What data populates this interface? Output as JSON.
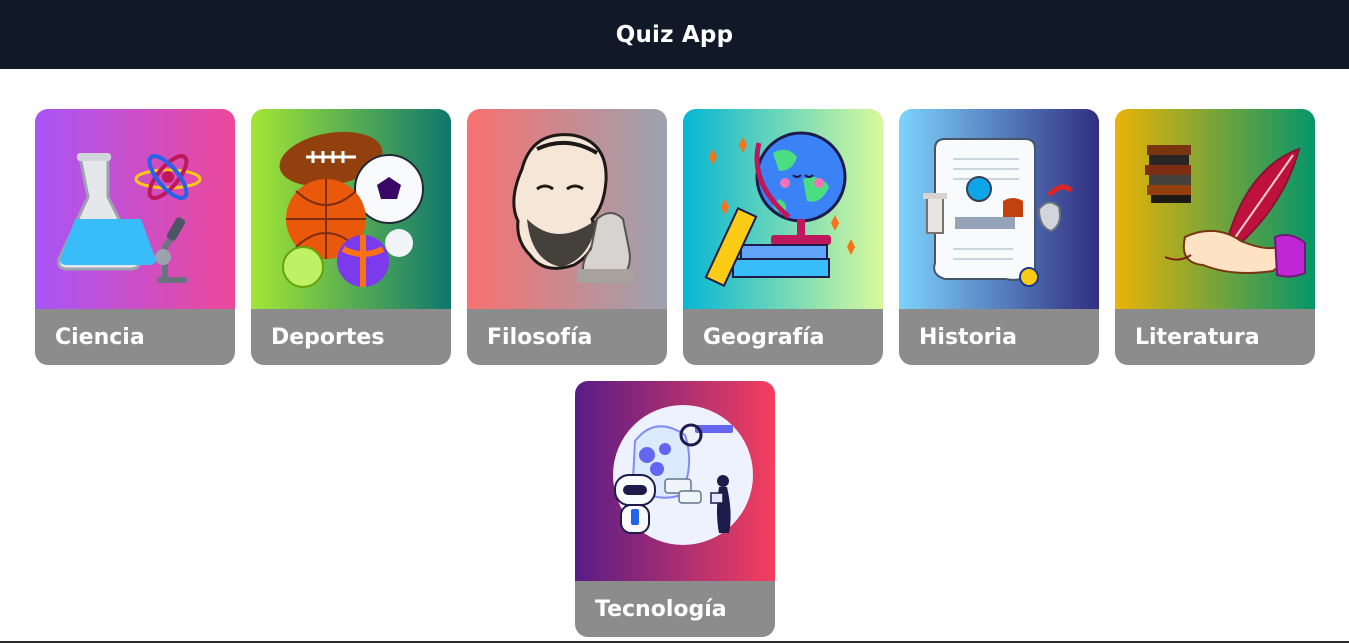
{
  "header": {
    "title": "Quiz App"
  },
  "categories": [
    {
      "label": "Ciencia",
      "icon": "science-flask-icon",
      "gradient": [
        "#a855f7",
        "#ec4899"
      ]
    },
    {
      "label": "Deportes",
      "icon": "sports-balls-icon",
      "gradient": [
        "#a3e635",
        "#0f766e"
      ]
    },
    {
      "label": "Filosofía",
      "icon": "philosopher-bust-icon",
      "gradient": [
        "#f87171",
        "#9ca3af"
      ]
    },
    {
      "label": "Geografía",
      "icon": "globe-icon",
      "gradient": [
        "#06b6d4",
        "#d9f99d"
      ]
    },
    {
      "label": "Historia",
      "icon": "history-scroll-icon",
      "gradient": [
        "#7dd3fc",
        "#312e81"
      ]
    },
    {
      "label": "Literatura",
      "icon": "books-quill-icon",
      "gradient": [
        "#eab308",
        "#059669"
      ]
    },
    {
      "label": "Tecnología",
      "icon": "technology-robot-icon",
      "gradient": [
        "#581c87",
        "#f43f5e"
      ]
    }
  ]
}
